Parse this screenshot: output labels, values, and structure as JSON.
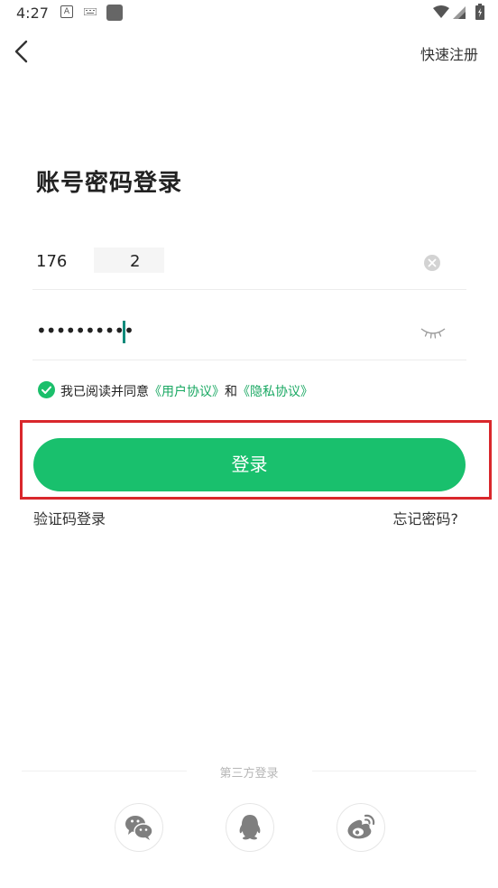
{
  "status_bar": {
    "time": "4:27",
    "icons": [
      "a-icon",
      "keyboard-icon",
      "app-square-icon",
      "wifi-icon",
      "signal-icon",
      "battery-icon"
    ]
  },
  "header": {
    "back_icon": "chevron-left-icon",
    "quick_register_label": "快速注册"
  },
  "title": "账号密码登录",
  "phone_field": {
    "value_prefix": "176",
    "value_suffix": "2",
    "clear_icon": "clear-circle-icon"
  },
  "password_field": {
    "masked_value": "••••••••••",
    "visibility_icon": "eye-closed-icon"
  },
  "agreement": {
    "checked": true,
    "prefix": "我已阅读并同意",
    "user_agreement": "《用户协议》",
    "connector": "和",
    "privacy_policy": "《隐私协议》"
  },
  "login_button_label": "登录",
  "links": {
    "sms_login": "验证码登录",
    "forgot_password": "忘记密码?"
  },
  "third_party": {
    "label": "第三方登录",
    "providers": [
      "wechat-icon",
      "qq-icon",
      "weibo-icon"
    ]
  },
  "colors": {
    "accent": "#19C06D",
    "link": "#19A862",
    "highlight_border": "#D9272C"
  }
}
